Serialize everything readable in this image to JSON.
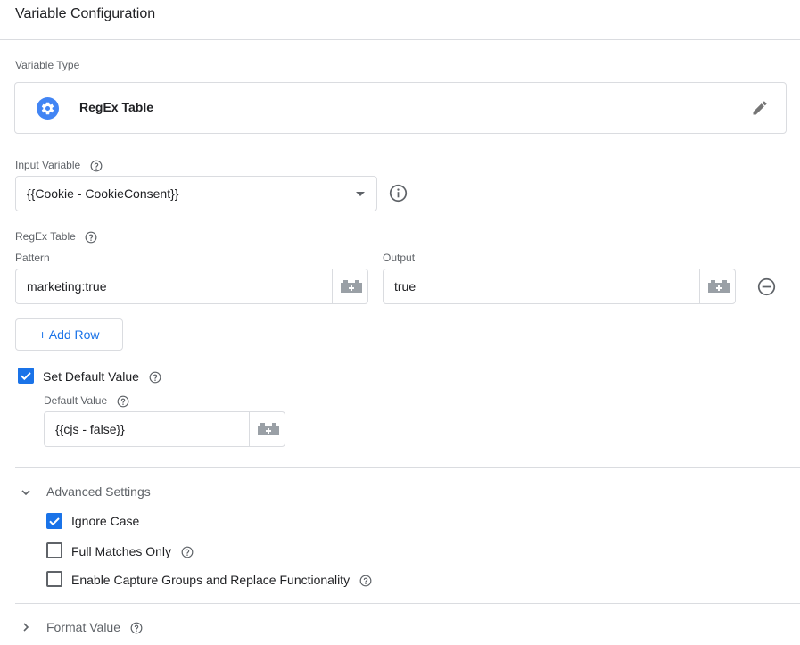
{
  "page": {
    "title": "Variable Configuration"
  },
  "variable_type": {
    "label": "Variable Type",
    "name": "RegEx Table",
    "icon": "gear-icon",
    "accent": "#4285f4"
  },
  "input_variable": {
    "label": "Input Variable",
    "value": "{{Cookie - CookieConsent}}"
  },
  "regex_table": {
    "label": "RegEx Table",
    "pattern_header": "Pattern",
    "output_header": "Output",
    "rows": [
      {
        "pattern": "marketing:true",
        "output": "true"
      }
    ],
    "add_row_label": "+ Add Row"
  },
  "default_value": {
    "checkbox_label": "Set Default Value",
    "checked": true,
    "field_label": "Default Value",
    "value": "{{cjs - false}}"
  },
  "advanced": {
    "title": "Advanced Settings",
    "expanded": true,
    "options": [
      {
        "label": "Ignore Case",
        "checked": true
      },
      {
        "label": "Full Matches Only",
        "checked": false
      },
      {
        "label": "Enable Capture Groups and Replace Functionality",
        "checked": false
      }
    ]
  },
  "format_value": {
    "title": "Format Value",
    "expanded": false
  },
  "colors": {
    "primary": "#1a73e8",
    "border": "#dadce0",
    "muted": "#5f6368"
  }
}
